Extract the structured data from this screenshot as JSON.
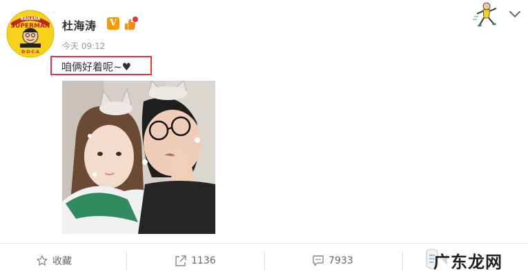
{
  "post": {
    "username": "杜海涛",
    "verified_badge": "V",
    "timestamp": "今天 09:12",
    "text": "咱俩好着呢~♥"
  },
  "avatar": {
    "lettering_top": "BANANA",
    "lettering_mid": "SUPERMAN",
    "lettering_bottom": "D·D·C·A"
  },
  "icons": {
    "collect": "star-icon",
    "share": "share-icon",
    "comment": "comment-icon",
    "like": "thumb-icon",
    "menu": "chevron-down-icon"
  },
  "actions": {
    "collect_label": "收藏",
    "share_count": "1136",
    "comment_count": "7933"
  },
  "watermark": {
    "text": "广东龙网"
  },
  "colors": {
    "highlight_border": "#e0373c",
    "verified": "#f59b00",
    "text_primary": "#333333",
    "text_meta": "#999999"
  }
}
